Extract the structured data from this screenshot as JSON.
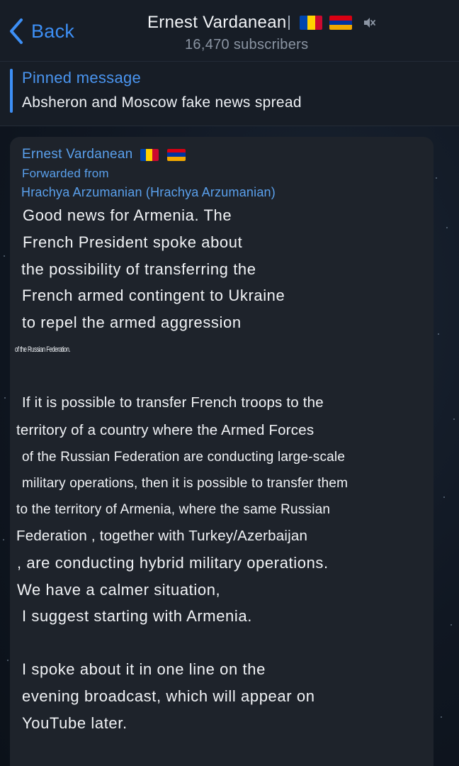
{
  "header": {
    "back_label": "Back",
    "channel_title": "Ernest Vardanean",
    "subscribers": "16,470 subscribers",
    "icons": [
      "chevron-left-icon",
      "moldova-flag-icon",
      "armenia-flag-icon",
      "mute-icon"
    ]
  },
  "pinned": {
    "label": "Pinned message",
    "text": "Absheron and Moscow fake news spread"
  },
  "message": {
    "author": "Ernest Vardanean",
    "forwarded_label": "Forwarded from",
    "forwarded_source": "Hrachya Arzumanian (Hrachya Arzumanian)",
    "lines": [
      "Good news for Armenia. The",
      "French President spoke about",
      "the possibility of transferring the",
      "French armed contingent to Ukraine",
      "to repel the armed aggression",
      "of the Russian Federation.",
      "If it is possible to transfer French troops to the",
      "territory of a country where the Armed Forces",
      "of the Russian Federation are conducting large-scale",
      "military operations, then it is possible to transfer them",
      "to the territory of Armenia, where the same Russian",
      "Federation , together with Turkey/Azerbaijan",
      ", are conducting hybrid military operations.",
      "We have a calmer situation,",
      "I suggest starting with Armenia.",
      "I spoke about it in one line on the",
      "evening broadcast, which will appear on",
      "YouTube later."
    ]
  },
  "colors": {
    "accent": "#3d8ff5",
    "header_bg": "#171d26",
    "bubble_bg": "#1e232b",
    "link": "#5aa0ec",
    "moldova_flag": [
      "#0046ae",
      "#ffd200",
      "#cc092f"
    ],
    "armenia_flag": [
      "#d90012",
      "#0033a0",
      "#f2a800"
    ]
  }
}
